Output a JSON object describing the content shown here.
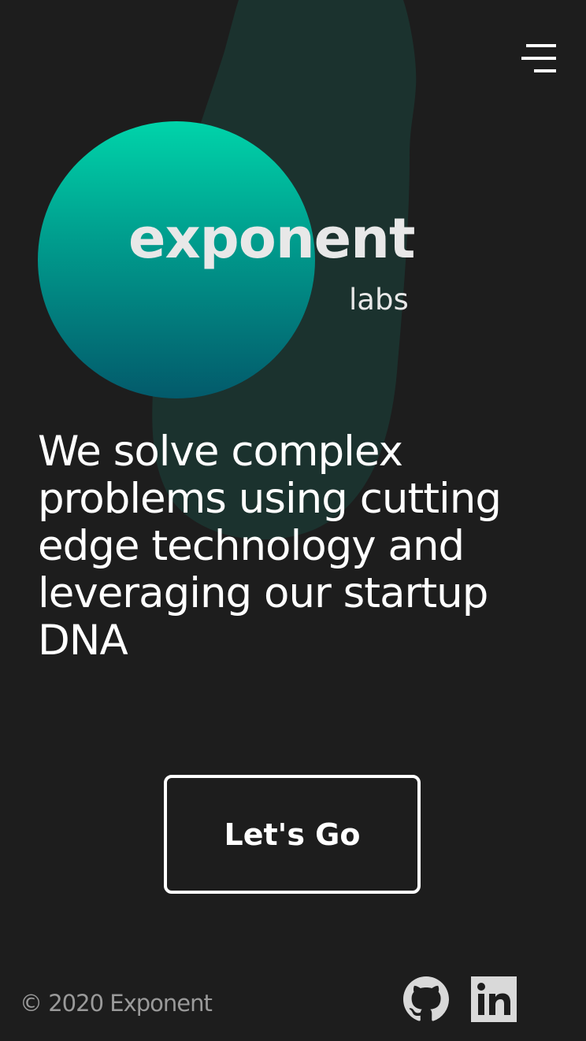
{
  "header": {
    "menu_icon": "hamburger-menu-icon"
  },
  "logo": {
    "word": "exponent",
    "sub": "labs"
  },
  "hero": {
    "tagline": "We solve complex problems using cutting edge technology and leveraging our startup DNA"
  },
  "cta": {
    "label": "Let's Go"
  },
  "footer": {
    "copyright": "© 2020 Exponent",
    "social_icons": [
      "github-icon",
      "linkedin-icon"
    ]
  },
  "colors": {
    "background": "#1d1d1d",
    "blob": "#1b322e",
    "circle_top": "#00d4aa",
    "circle_bottom": "#035a6b",
    "text": "#ffffff",
    "muted": "#9a9a9a",
    "icon": "#d9d9d9"
  }
}
